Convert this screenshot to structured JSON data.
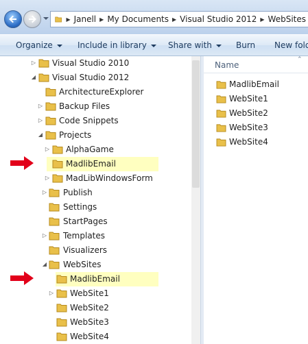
{
  "address": {
    "crumbs": [
      "Janell",
      "My Documents",
      "Visual Studio 2012",
      "WebSites"
    ]
  },
  "toolbar": {
    "organize": "Organize",
    "include": "Include in library",
    "share": "Share with",
    "burn": "Burn",
    "new_folder": "New fold"
  },
  "nav": {
    "vs2010": "Visual Studio 2010",
    "vs2012": "Visual Studio 2012",
    "arch": "ArchitectureExplorer",
    "backup": "Backup Files",
    "snippets": "Code Snippets",
    "projects": "Projects",
    "alphagame": "AlphaGame",
    "madlib_proj": "MadlibEmail",
    "madlib_form": "MadLibWindowsForm",
    "publish": "Publish",
    "settings": "Settings",
    "startpages": "StartPages",
    "templates": "Templates",
    "visualizers": "Visualizers",
    "websites": "WebSites",
    "madlib_web": "MadlibEmail",
    "ws1": "WebSite1",
    "ws2": "WebSite2",
    "ws3": "WebSite3",
    "ws4": "WebSite4"
  },
  "files": {
    "column_name": "Name",
    "items": [
      "MadlibEmail",
      "WebSite1",
      "WebSite2",
      "WebSite3",
      "WebSite4"
    ]
  },
  "colors": {
    "highlight": "#ffffc0",
    "annotation_arrow": "#e2001a",
    "folder": "#e9c04a"
  }
}
